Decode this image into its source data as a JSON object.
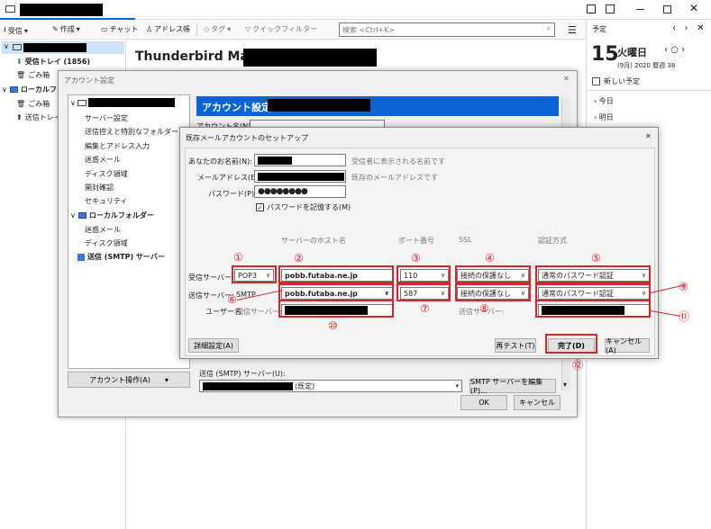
{
  "toolbar": {
    "receive": "受信",
    "compose": "作成",
    "chat": "チャット",
    "addressbook": "アドレス帳",
    "tag": "タグ",
    "quickfilter": "クイックフィルター",
    "search_placeholder": "検索 <Ctrl+K>"
  },
  "folders": {
    "inbox": "受信トレイ (1856)",
    "trash": "ごみ箱",
    "local": "ローカルフォル",
    "local_trash": "ごみ箱",
    "local_sent": "送信トレイ"
  },
  "main_title": "Thunderbird Mail -",
  "calendar": {
    "header": "予定",
    "day": "15",
    "weekday": "火曜日",
    "subdate": "(9月) 2020 暦週 38",
    "new_event": "新しい予定",
    "today": "今日",
    "tomorrow": "明日"
  },
  "account_settings": {
    "window_title": "アカウント設定",
    "header": "アカウント設定 -",
    "account_name_label": "アカウント名(N):",
    "tree": [
      "サーバー設定",
      "送信控えと特別なフォルダー",
      "編集とアドレス入力",
      "迷惑メール",
      "ディスク領域",
      "開封確認",
      "セキュリティ"
    ],
    "local_folder": "ローカルフォルダー",
    "local_items": [
      "迷惑メール",
      "ディスク領域"
    ],
    "smtp_server": "送信 (SMTP) サーバー",
    "account_ops": "アカウント操作(A)",
    "smtp_label": "送信 (SMTP) サーバー(U):",
    "smtp_value": "(既定)",
    "smtp_edit": "SMTP サーバーを編集(P)...",
    "ok": "OK",
    "cancel": "キャンセル"
  },
  "setup": {
    "title": "既存メールアカウントのセットアップ",
    "name_label": "あなたのお名前(N):",
    "name_hint": "受信者に表示される名前です",
    "email_label": "メールアドレス(E):",
    "email_hint": "既存のメールアドレスです",
    "password_label": "パスワード(P):",
    "password_value": "●●●●●●●●",
    "remember_label": "パスワードを記憶する(M)",
    "col_host": "サーバーのホスト名",
    "col_port": "ポート番号",
    "col_ssl": "SSL",
    "col_auth": "認証方式",
    "incoming_label": "受信サーバー:",
    "incoming_proto": "POP3",
    "incoming_host": "pobb.futaba.ne.jp",
    "incoming_port": "110",
    "incoming_ssl": "接続の保護なし",
    "incoming_auth": "通常のパスワード認証",
    "outgoing_label": "送信サーバー:",
    "outgoing_proto": "SMTP",
    "outgoing_host": "pobb.futaba.ne.jp",
    "outgoing_port": "587",
    "outgoing_ssl": "接続の保護なし",
    "outgoing_auth": "通常のパスワード認証",
    "username_label": "ユーザー名:",
    "in_server_label": "受信サーバー:",
    "out_server_label": "送信サーバー:",
    "advanced": "詳細設定(A)",
    "retest": "再テスト(T)",
    "done": "完了(D)",
    "cancel": "キャンセル(A)",
    "close": "✕"
  },
  "annotations": [
    "①",
    "②",
    "③",
    "④",
    "⑤",
    "⑥",
    "⑦",
    "⑧",
    "⑨",
    "⑩",
    "⑪",
    "⑫"
  ],
  "colors": {
    "accent": "#0a64d6",
    "annotation": "#d8242a"
  }
}
